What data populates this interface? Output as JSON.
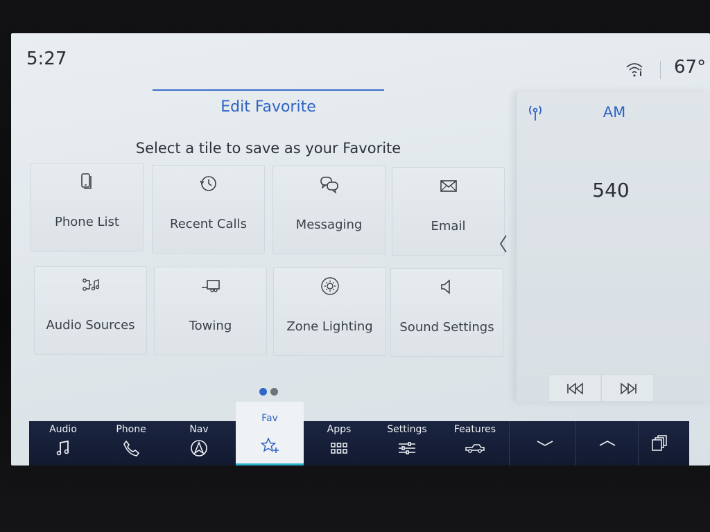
{
  "status": {
    "time": "5:27",
    "temperature": "67°",
    "wifi_icon": "wifi-icon"
  },
  "header": {
    "title": "Edit Favorite",
    "subtitle": "Select a tile to save as your Favorite"
  },
  "tiles": [
    {
      "label": "Phone List",
      "icon": "phone-list-icon"
    },
    {
      "label": "Recent Calls",
      "icon": "recent-calls-icon"
    },
    {
      "label": "Messaging",
      "icon": "messaging-icon"
    },
    {
      "label": "Email",
      "icon": "email-icon"
    },
    {
      "label": "Audio Sources",
      "icon": "audio-sources-icon"
    },
    {
      "label": "Towing",
      "icon": "towing-icon"
    },
    {
      "label": "Zone Lighting",
      "icon": "zone-lighting-icon"
    },
    {
      "label": "Sound Settings",
      "icon": "sound-settings-icon"
    }
  ],
  "pagination": {
    "current_page": 1,
    "total_pages": 2
  },
  "radio": {
    "band": "AM",
    "frequency": "540",
    "antenna_icon": "antenna-icon"
  },
  "nav": {
    "items": [
      {
        "label": "Audio",
        "icon": "music-note-icon"
      },
      {
        "label": "Phone",
        "icon": "phone-icon"
      },
      {
        "label": "Nav",
        "icon": "navigation-icon"
      },
      {
        "label": "Fav",
        "icon": "favorite-star-icon",
        "active": true
      },
      {
        "label": "Apps",
        "icon": "apps-grid-icon"
      },
      {
        "label": "Settings",
        "icon": "settings-sliders-icon"
      },
      {
        "label": "Features",
        "icon": "truck-icon"
      }
    ]
  },
  "colors": {
    "accent": "#2f63c4",
    "nav_background": "#1b2541",
    "screen_background": "#e4eaed",
    "active_underline": "#2ab0c6"
  }
}
